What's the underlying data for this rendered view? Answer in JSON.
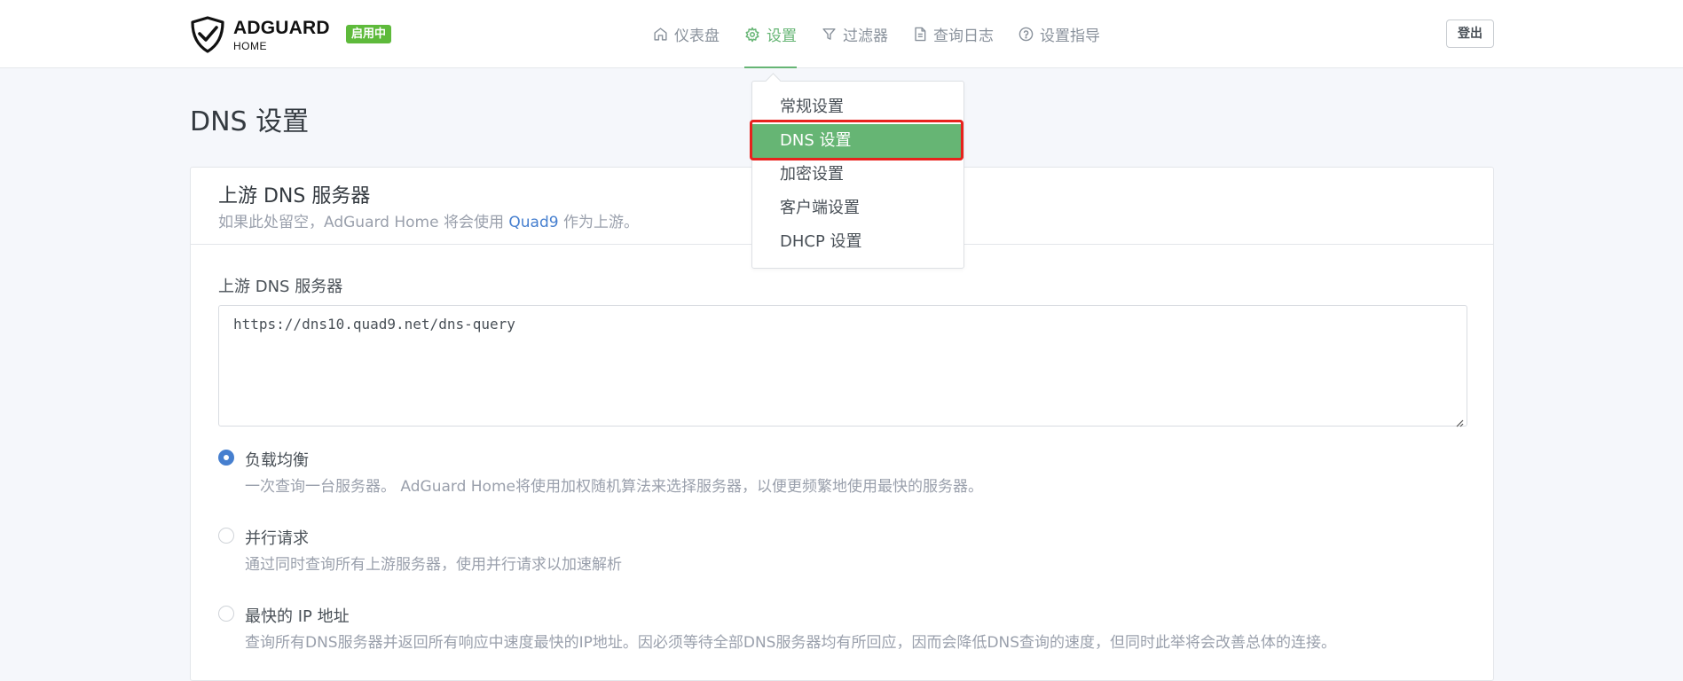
{
  "header": {
    "logo_title": "ADGUARD",
    "logo_subtitle": "HOME",
    "status_badge": "启用中",
    "nav": [
      {
        "label": "仪表盘",
        "icon": "home-icon"
      },
      {
        "label": "设置",
        "icon": "gear-icon",
        "active": true
      },
      {
        "label": "过滤器",
        "icon": "filter-icon"
      },
      {
        "label": "查询日志",
        "icon": "document-icon"
      },
      {
        "label": "设置指导",
        "icon": "help-circle-icon"
      }
    ],
    "logout_label": "登出"
  },
  "settings_menu": {
    "items": [
      "常规设置",
      "DNS 设置",
      "加密设置",
      "客户端设置",
      "DHCP 设置"
    ],
    "selected": "DNS 设置"
  },
  "page": {
    "title": "DNS 设置"
  },
  "upstream_card": {
    "title": "上游 DNS 服务器",
    "subtitle_prefix": "如果此处留空，AdGuard Home 将会使用 ",
    "subtitle_link": "Quad9",
    "subtitle_suffix": " 作为上游。",
    "field_label": "上游 DNS 服务器",
    "textarea_value": "https://dns10.quad9.net/dns-query",
    "modes": [
      {
        "label": "负载均衡",
        "description": "一次查询一台服务器。 AdGuard Home将使用加权随机算法来选择服务器，以便更频繁地使用最快的服务器。",
        "checked": true
      },
      {
        "label": "并行请求",
        "description": "通过同时查询所有上游服务器，使用并行请求以加速解析",
        "checked": false
      },
      {
        "label": "最快的 IP 地址",
        "description": "查询所有DNS服务器并返回所有响应中速度最快的IP地址。因必须等待全部DNS服务器均有所回应，因而会降低DNS查询的速度，但同时此举将会改善总体的连接。",
        "checked": false
      }
    ]
  },
  "colors": {
    "accent_green": "#66b574",
    "badge_green": "#5eba3b",
    "link_blue": "#467fcf",
    "highlight_red": "#e8221d"
  }
}
